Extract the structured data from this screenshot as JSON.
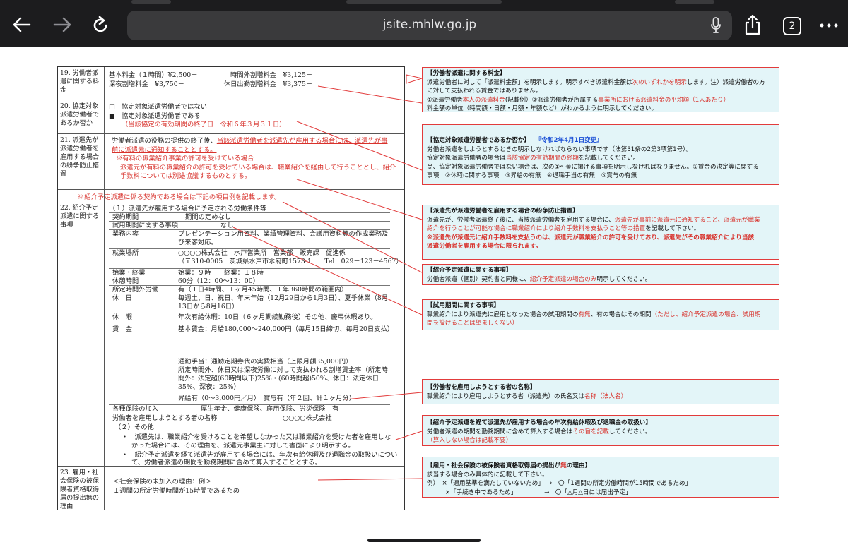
{
  "browser": {
    "url": "jsite.mhlw.go.jp",
    "tab_count": "2",
    "back_icon": "arrow-left-icon",
    "forward_icon": "arrow-right-icon",
    "reload_icon": "reload-icon",
    "mic_icon": "microphone-icon",
    "share_icon": "share-icon",
    "more_icon": "more-dots-icon"
  },
  "form": {
    "row19": {
      "label": "19. 労働者派遣に関する料金",
      "lines": [
        "基本料金（１時間）¥2,500－　　　　　時間外割増料金　¥3,125－",
        "深夜割増料金　¥3,750－　　　　　　休日出勤割増料金　¥3,375－"
      ]
    },
    "row20": {
      "label": "20. 協定対象派遣労働者であるか否か",
      "opt1": "□　協定対象派遣労働者ではない",
      "opt2": "■　協定対象派遣労働者である",
      "note": "（当該協定の有効期間の終了日　令和６年３月３１日）"
    },
    "row21": {
      "label": "21. 派遣先が派遣労働者を雇用する場合の紛争防止措置",
      "line1a": "労働者派遣の役務の提供の終了後、",
      "line1b": "当該派遣労働者を派遣先が雇用する場合には、派遣先が事",
      "line2": "前に派遣元に通知することとする。",
      "note1": "※有料の職業紹介事業の許可を受けている場合",
      "note2": "派遣元が有料の職業紹介の許可を受けている場合は、職業紹介を経由して行うこととし、紹介",
      "note3": "手数料については別途協議するものとする。"
    },
    "row22": {
      "header_note": "※紹介予定派遣に係る契約である場合は下記の項目例を記載します。",
      "label": "22. 紹介予定派遣に関する事項",
      "sub1": "（１）派遣先が雇用する場合に予定される労働条件等",
      "items": [
        {
          "k": "契約期間",
          "v": "期間の定めなし"
        },
        {
          "k": "試用期間に関する事項",
          "v": "なし"
        },
        {
          "k": "業務内容",
          "v": "プレゼンテーション用資料、業績管理資料、会議用資料等の作成業務及"
        },
        {
          "k": "",
          "v": "び来客対応。"
        },
        {
          "k": "就業場所",
          "v": "○○○○株式会社　水戸営業所　営業部　販売課　促進係"
        },
        {
          "k": "",
          "v": "（〒310-0005　茨城県水戸市水府町1573-1　　Tel　029－123－4567）"
        },
        {
          "k": "始業・終業",
          "v": "始業：９時　　終業：１８時"
        },
        {
          "k": "休憩時間",
          "v": "60分（12：00～13：00）"
        },
        {
          "k": "所定時間外労働",
          "v": "有（１日4時間、１ヶ月45時間、１年360時間の範囲内）"
        },
        {
          "k": "休　日",
          "v": "毎週土、日、祝日、年末年始（12月29日から1月3日）、夏季休業（8月"
        },
        {
          "k": "",
          "v": "13日から8月16日）"
        },
        {
          "k": "休　暇",
          "v": "年次有給休暇：10日（６ヶ月勤続勤務後）その他、慶弔休暇あり。"
        },
        {
          "k": "賃　金",
          "v": "基本賃金：月給180,000～240,000円（毎月15日締切、毎月20日支払）"
        }
      ],
      "wage_lines": [
        "通勤手当：通勤定期券代の実費相当（上限月額35,000円）",
        "所定時間外、休日又は深夜労働に対して支払われる割増賃金率（所定時",
        "間外：法定超(60時間以下)25%・(60時間超)50%、休日：法定休日",
        "35%、深夜：25%）",
        "昇給有（0～3,000円／月）　賞与有（年２回、計１ヶ月分）"
      ],
      "insurance_k": "各種保険の加入",
      "insurance_v": "厚生年金、健康保険、雇用保険、労災保険　有",
      "employer_k": "労働者を雇用しようとする者の名称",
      "employer_v": "○○○○株式会社",
      "sub2": "（２）その他",
      "other1a": "・　派遣先は、職業紹介を受けることを希望しなかった又は職業紹介を受けた者を雇用しな",
      "other1b": "かった場合には、その理由を、派遣元事業主に対して書面により明示する。",
      "other2a": "・　紹介予定派遣を経て派遣先が雇用する場合には、年次有給休暇及び退職金の取扱いについ",
      "other2b": "て、労働者派遣の期間を勤務期間に含めて算入することとする。"
    },
    "row23": {
      "label": "23. 雇用・社会保険の被保険者資格取得届の提出無の理由",
      "line1": "＜社会保険の未加入の理由：例＞",
      "line2": "１週間の所定労働時間が15時間であるため"
    }
  },
  "callouts": [
    {
      "title": "【労働者派遣に関する料金】",
      "l1a": "派遣労働者に対して「派遣料金額」を明示します。明示すべき派遣料金額は",
      "l1b": "次のいずれかを明示",
      "l1c": "します。注）派遣労働者の方",
      "l2": "に対して支払われる賃金ではありません。",
      "l3a": "①派遣労働者",
      "l3b": "本人の派遣料金",
      "l3c": "(記載例）②派遣労働者が所属する",
      "l3d": "事業所における派遣料金の平均額（1人あたり）",
      "l4": "料金額の単位（時間額・日額・月額・年額など）がわかるように明示してください。"
    },
    {
      "title": "【協定対象派遣労働者であるか否か】",
      "title_b": "『令和2年4月1日変更』",
      "l1": "労働者派遣をしようとするときの明示しなければならない事項です（法第31条の2第3項第1号）。",
      "l2a": "協定対象派遣労働者の場合は",
      "l2b": "当該協定の有効期間の終期",
      "l2c": "を記載してください。",
      "l3": "尚、協定対象派遣労働者ではない場合は、次の①～⑤に掲げる事項を明示しなければなりません。①賃金の決定等に関する",
      "l4": "事項　②休暇に関する事項　③昇給の有無　④退職手当の有無　⑤賞与の有無"
    },
    {
      "title": "【派遣先が派遣労働者を雇用する場合の紛争防止措置】",
      "l1a": "派遣先が、労働者派遣終了後に、当該派遣労働者を雇用する場合に、",
      "l1b": "派遣先が事前に派遣元に通知すること、派遣元が職業",
      "l2a": "紹介を行うことが可能な場合に職業紹介により紹介手数料を支払うこと等の措置",
      "l2b": "を記載して下さい。",
      "l3": "※派遣先が派遣元に紹介手数料を支払うのは、派遣元が職業紹介の許可を受けており、派遣先がその職業紹介により当該",
      "l4": "派遣労働者を雇用する場合に限られます。"
    },
    {
      "title": "【紹介予定派遣に関する事項】",
      "l1a": "労働者派遣（個別）契約書と同様に、",
      "l1b": "紹介予定派遣の場合のみ",
      "l1c": "明示してください。"
    },
    {
      "title": "【試用期間に関する事項】",
      "l1a": "職業紹介により派遣先に雇用となった場合の試用期間の",
      "l1b": "有無",
      "l1c": "、有の場合はその期間",
      "l1d": "（ただし、紹介予定派遣の場合、試用期",
      "l2": "間を設けることは望ましくない）"
    },
    {
      "title": "【労働者を雇用しようとする者の名称】",
      "l1a": "職業紹介により雇用しようとする者（派遣先）の氏名又は",
      "l1b": "名称（法人名）"
    },
    {
      "title": "【紹介予定派遣を経て派遣先が雇用する場合の年次有給休暇及び退職金の取扱い】",
      "l1a": "労働者派遣の期間を勤務期間に含めて算入する場合は",
      "l1b": "その旨を記載",
      "l1c": "してください。",
      "l2": "（算入しない場合は記載不要）"
    },
    {
      "title_a": "【雇用・社会保険の被保険者資格取得届の提出が",
      "title_b": "無",
      "title_c": "の理由】",
      "l1": "該当する場合のみ具体的に記載して下さい。",
      "l2": "例）　×「適用基準を満たしていないため」　→　〇「1週間の所定労働時間が15時間であるため」",
      "l3": "　　　×「手続き中であるため」　　　　　→　〇「△月△日には届出予定」"
    }
  ]
}
